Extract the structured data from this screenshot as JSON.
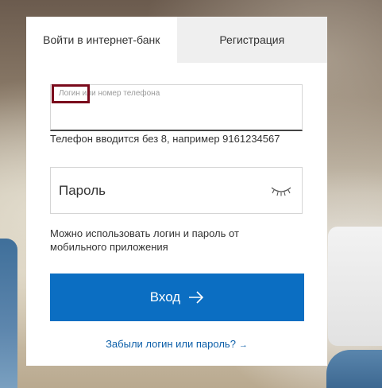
{
  "tabs": {
    "login": "Войти в интернет-банк",
    "register": "Регистрация"
  },
  "login_field": {
    "placeholder": "Логин или номер телефона",
    "value": ""
  },
  "phone_hint": "Телефон вводится без 8, например 9161234567",
  "password_field": {
    "label": "Пароль",
    "toggle_icon": "eye-closed-icon"
  },
  "app_hint": "Можно использовать логин и пароль от мобильного приложения",
  "login_button": {
    "label": "Вход",
    "icon": "arrow-right-icon",
    "color": "#0b6ec2"
  },
  "forgot_link": {
    "label": "Забыли логин или пароль?",
    "icon": "→"
  },
  "highlight_color": "#7a0a1c"
}
